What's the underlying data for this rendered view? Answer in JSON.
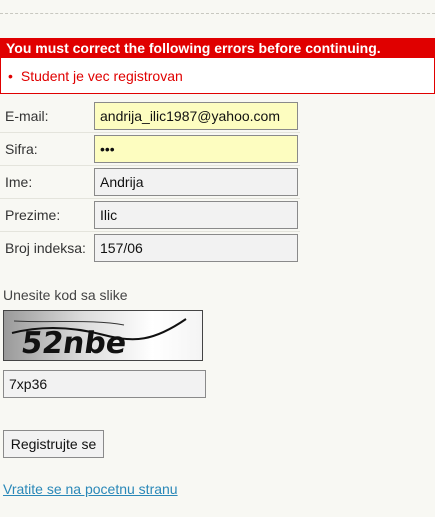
{
  "errors": {
    "title": "You must correct the following errors before continuing.",
    "items": [
      "Student je vec registrovan"
    ]
  },
  "form": {
    "email": {
      "label": "E-mail:",
      "value": "andrija_ilic1987@yahoo.com"
    },
    "password": {
      "label": "Sifra:",
      "value": "•••"
    },
    "first_name": {
      "label": "Ime:",
      "value": "Andrija"
    },
    "last_name": {
      "label": "Prezime:",
      "value": "Ilic"
    },
    "index": {
      "label": "Broj indeksa:",
      "value": "157/06"
    }
  },
  "captcha": {
    "label": "Unesite kod sa slike",
    "image_text": "52nbe",
    "input_value": "7xp36"
  },
  "actions": {
    "register_label": "Registrujte se",
    "back_link": "Vratite se na pocetnu stranu"
  },
  "colors": {
    "error_red": "#e00000",
    "highlight_yellow": "#fdfdc0",
    "link_blue": "#2a88b8"
  }
}
